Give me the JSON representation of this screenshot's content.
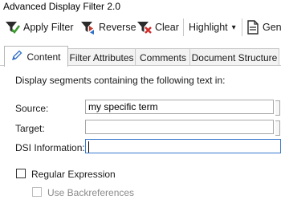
{
  "window": {
    "title": "Advanced Display Filter 2.0"
  },
  "toolbar": {
    "apply_filter": "Apply Filter",
    "reverse": "Reverse",
    "clear": "Clear",
    "highlight": "Highlight",
    "highlight_arrow": "▾",
    "gen": "Gen"
  },
  "tabs": [
    {
      "label": "Content",
      "active": true
    },
    {
      "label": "Filter Attributes",
      "active": false
    },
    {
      "label": "Comments",
      "active": false
    },
    {
      "label": "Document Structure",
      "active": false
    }
  ],
  "content": {
    "description": "Display segments containing the following text in:",
    "source_label": "Source:",
    "source_value": "my specific term",
    "target_label": "Target:",
    "target_value": "",
    "dsi_label": "DSI Information:",
    "dsi_value": "",
    "regex_label": "Regular Expression",
    "regex_checked": false,
    "backref_label": "Use Backreferences",
    "backref_checked": false,
    "backref_enabled": false
  },
  "colors": {
    "funnel": "#2b2b2b",
    "check_green": "#3c9a2e",
    "clear_red": "#d42b2b",
    "pencil": "#2f6fc9"
  }
}
